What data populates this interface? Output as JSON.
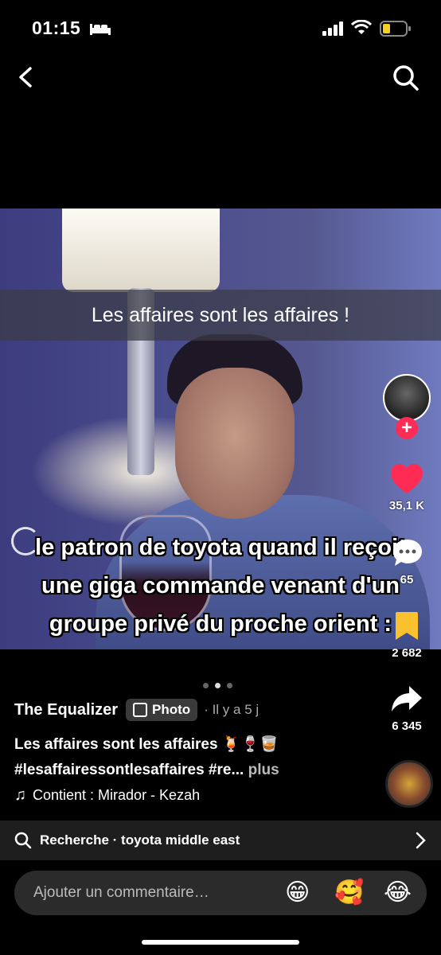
{
  "status": {
    "time": "01:15",
    "battery_color": "#f5d021"
  },
  "nav": {
    "back_icon": "chevron-left-icon",
    "search_icon": "search-icon"
  },
  "post": {
    "caption_bar": "Les affaires sont les affaires !",
    "overlay_lines": [
      "le patron de toyota quand il reçoit",
      "une giga commande venant d'un",
      "groupe privé du proche orient :"
    ],
    "carousel": {
      "count": 3,
      "active_index": 1
    }
  },
  "rail": {
    "likes": "35,1 K",
    "comments": "65",
    "saves": "2 682",
    "shares": "6 345",
    "like_color": "#fe2c55",
    "save_color": "#f9c12e"
  },
  "meta": {
    "author": "The Equalizer",
    "badge": "Photo",
    "ago": "· Il y a 5 j",
    "desc_line1": "Les affaires sont les affaires 🍹🍷🥃",
    "desc_line2": "#lesaffairessontlesaffaires #re...",
    "more": " plus",
    "music": "Contient : Mirador - Kezah"
  },
  "search_bar": {
    "text": "Recherche · toyota middle east"
  },
  "comment_box": {
    "placeholder": "Ajouter un commentaire…",
    "emojis": [
      "😁",
      "🥰",
      "😂"
    ]
  }
}
